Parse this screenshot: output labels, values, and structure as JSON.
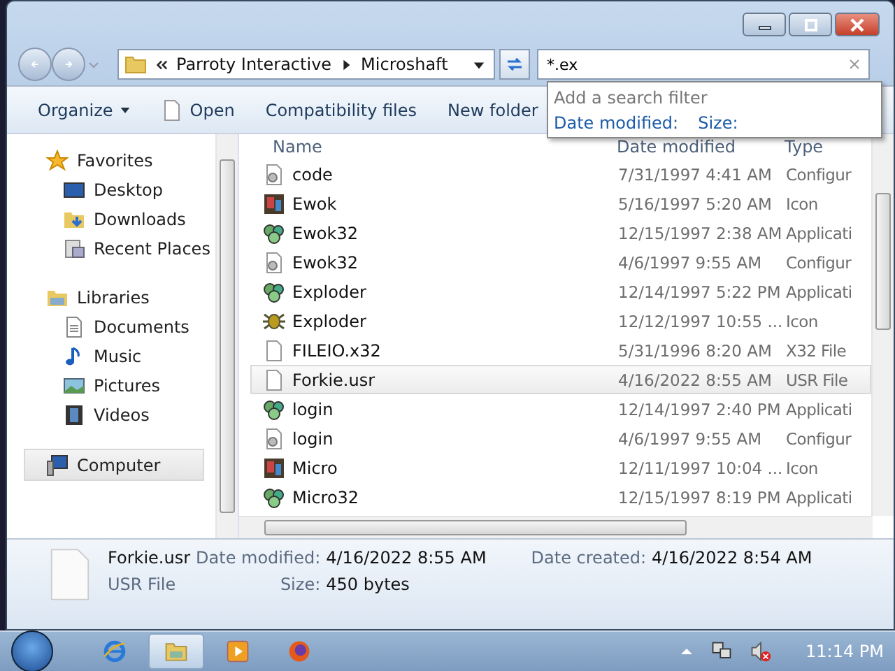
{
  "address_bar": {
    "path": [
      "Parroty Interactive",
      "Microshaft"
    ]
  },
  "search": {
    "value": "*.ex",
    "hint": "Add a search filter",
    "filters": [
      "Date modified:",
      "Size:"
    ]
  },
  "toolbar": [
    {
      "kind": "menu",
      "label": "Organize"
    },
    {
      "kind": "open",
      "label": "Open"
    },
    {
      "kind": "plain",
      "label": "Compatibility files"
    },
    {
      "kind": "plain",
      "label": "New folder"
    }
  ],
  "navigation": [
    {
      "label": "Favorites",
      "kind": "star",
      "selected": false,
      "children": [
        {
          "label": "Desktop",
          "kind": "desktop",
          "selected": false
        },
        {
          "label": "Downloads",
          "kind": "downloads",
          "selected": false
        },
        {
          "label": "Recent Places",
          "kind": "recent",
          "selected": false
        }
      ]
    },
    {
      "label": "Libraries",
      "kind": "libraries",
      "selected": false,
      "children": [
        {
          "label": "Documents",
          "kind": "document",
          "selected": false
        },
        {
          "label": "Music",
          "kind": "music",
          "selected": false
        },
        {
          "label": "Pictures",
          "kind": "pictures",
          "selected": false
        },
        {
          "label": "Videos",
          "kind": "videos",
          "selected": false
        }
      ]
    },
    {
      "label": "Computer",
      "kind": "computer",
      "selected": true
    }
  ],
  "file_list": {
    "columns": [
      "Name",
      "Date modified",
      "Type"
    ],
    "rows": [
      {
        "kind": "config",
        "name": "code",
        "date": "7/31/1997 4:41 AM",
        "type": "Configur",
        "selected": false
      },
      {
        "kind": "image",
        "name": "Ewok",
        "date": "5/16/1997 5:20 AM",
        "type": "Icon",
        "selected": false
      },
      {
        "kind": "app",
        "name": "Ewok32",
        "date": "12/15/1997 2:38 AM",
        "type": "Applicati",
        "selected": false
      },
      {
        "kind": "config",
        "name": "Ewok32",
        "date": "4/6/1997 9:55 AM",
        "type": "Configur",
        "selected": false
      },
      {
        "kind": "app",
        "name": "Exploder",
        "date": "12/14/1997 5:22 PM",
        "type": "Applicati",
        "selected": false
      },
      {
        "kind": "bug",
        "name": "Exploder",
        "date": "12/12/1997 10:55 ...",
        "type": "Icon",
        "selected": false
      },
      {
        "kind": "blank",
        "name": "FILEIO.x32",
        "date": "5/31/1996 8:20 AM",
        "type": "X32 File",
        "selected": false
      },
      {
        "kind": "blank",
        "name": "Forkie.usr",
        "date": "4/16/2022 8:55 AM",
        "type": "USR File",
        "selected": true
      },
      {
        "kind": "app",
        "name": "login",
        "date": "12/14/1997 2:40 PM",
        "type": "Applicati",
        "selected": false
      },
      {
        "kind": "config",
        "name": "login",
        "date": "4/6/1997 9:55 AM",
        "type": "Configur",
        "selected": false
      },
      {
        "kind": "image",
        "name": "Micro",
        "date": "12/11/1997 10:04 ...",
        "type": "Icon",
        "selected": false
      },
      {
        "kind": "app",
        "name": "Micro32",
        "date": "12/15/1997 8:19 PM",
        "type": "Applicati",
        "selected": false
      }
    ]
  },
  "details_pane": {
    "name": "Forkie.usr",
    "type": "USR File",
    "fields": [
      {
        "label": "Date modified:",
        "value": "4/16/2022 8:55 AM"
      },
      {
        "label": "Date created:",
        "value": "4/16/2022 8:54 AM"
      },
      {
        "label": "Size:",
        "value": "450 bytes"
      }
    ]
  },
  "taskbar": {
    "apps": [
      {
        "kind": "browser",
        "selected": false
      },
      {
        "kind": "explorer",
        "selected": true
      },
      {
        "kind": "player",
        "selected": false
      },
      {
        "kind": "firefox",
        "selected": false
      }
    ],
    "clock": "11:14 PM"
  }
}
